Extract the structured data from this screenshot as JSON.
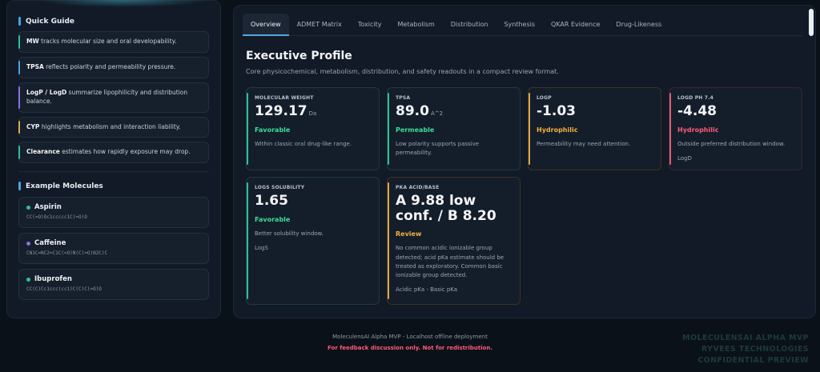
{
  "sidebar": {
    "quick_guide_title": "Quick Guide",
    "guide_items": [
      {
        "term": "MW",
        "text": " tracks molecular size and oral developability.",
        "accent": "#2fbf9a"
      },
      {
        "term": "TPSA",
        "text": " reflects polarity and permeability pressure.",
        "accent": "#4aa3df"
      },
      {
        "term": "LogP / LogD",
        "text": " summarize lipophilicity and distribution balance.",
        "accent": "#8a6fe0"
      },
      {
        "term": "CYP",
        "text": " highlights metabolism and interaction liability.",
        "accent": "#e0a74a"
      },
      {
        "term": "Clearance",
        "text": " estimates how rapidly exposure may drop.",
        "accent": "#2fbf9a"
      }
    ],
    "examples_title": "Example Molecules",
    "molecules": [
      {
        "name": "Aspirin",
        "smiles": "CC(=O)Oc1ccccc1C(=O)O",
        "dot": "#2fbf9a"
      },
      {
        "name": "Caffeine",
        "smiles": "CN1C=NC2=C1C(=O)N(C(=O)N2C)C",
        "dot": "#8a6fe0"
      },
      {
        "name": "Ibuprofen",
        "smiles": "CC(C)Cc1ccc(cc1)C(C)C(=O)O",
        "dot": "#2fbf9a"
      }
    ]
  },
  "tabs": [
    "Overview",
    "ADMET Matrix",
    "Toxicity",
    "Metabolism",
    "Distribution",
    "Synthesis",
    "QKAR Evidence",
    "Drug-Likeness"
  ],
  "main": {
    "title": "Executive Profile",
    "subtitle": "Core physicochemical, metabolism, distribution, and safety readouts in a compact review format."
  },
  "cards": [
    {
      "label": "MOLECULAR WEIGHT",
      "value": "129.17",
      "unit": "Da",
      "status": "Favorable",
      "status_color": "#3ddc97",
      "desc": "Within classic oral drug-like range.",
      "extra": "",
      "accent": "#2fbf9a",
      "kind": "good"
    },
    {
      "label": "TPSA",
      "value": "89.0",
      "unit": "A^2",
      "status": "Permeable",
      "status_color": "#3ddc97",
      "desc": "Low polarity supports passive permeability.",
      "extra": "",
      "accent": "#2fbf9a",
      "kind": "good"
    },
    {
      "label": "LOGP",
      "value": "-1.03",
      "unit": "",
      "status": "Hydrophilic",
      "status_color": "#f0b23e",
      "desc": "Permeability may need attention.",
      "extra": "",
      "accent": "#e0a74a",
      "kind": "warn"
    },
    {
      "label": "LOGD PH 7.4",
      "value": "-4.48",
      "unit": "",
      "status": "Hydrophilic",
      "status_color": "#ff5a7a",
      "desc": "Outside preferred distribution window.",
      "extra": "LogD",
      "accent": "#e05a7a",
      "kind": "bad"
    },
    {
      "label": "LOGS SOLUBILITY",
      "value": "1.65",
      "unit": "",
      "status": "Favorable",
      "status_color": "#3ddc97",
      "desc": "Better solubility window.",
      "extra": "LogS",
      "accent": "#2fbf9a",
      "kind": "good"
    },
    {
      "label": "PKA ACID/BASE",
      "value": "A 9.88 low conf. / B 8.20",
      "unit": "",
      "status": "Review",
      "status_color": "#f0b23e",
      "desc": "No common acidic ionizable group detected; acid pKa estimate should be treated as exploratory. Common basic ionizable group detected.",
      "extra": "Acidic pKa - Basic pKa",
      "accent": "#e0a74a",
      "kind": "warn"
    }
  ],
  "footer": {
    "line1": "MoleculensAI Alpha MVP - Localhost offline deployment",
    "line2": "For feedback discussion only. Not for redistribution."
  },
  "watermark": [
    "MOLECULENSAI ALPHA MVP",
    "RYVEES TECHNOLOGIES",
    "CONFIDENTIAL PREVIEW"
  ]
}
